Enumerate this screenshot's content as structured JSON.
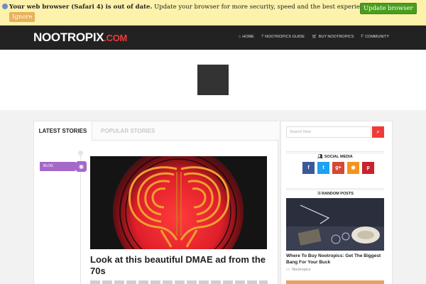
{
  "browser_notice": {
    "bold_text": "Your web browser (Safari 4) is out of date.",
    "text": " Update your browser for more security, speed and the best experience on this site.",
    "update_label": "Update browser",
    "ignore_label": "Ignore"
  },
  "header": {
    "logo_main": "NOOTROPIX",
    "logo_suffix": ".COM",
    "menu": [
      {
        "label": "HOME",
        "icon": "home-icon"
      },
      {
        "label": "NOOTROPICS GUIDE",
        "icon": "question-icon"
      },
      {
        "label": "BUY NOOTROPICS",
        "icon": "cart-icon"
      },
      {
        "label": "COMMUNITY",
        "icon": "facebook-icon"
      }
    ]
  },
  "tabs": {
    "latest": "LATEST STORIES",
    "popular": "POPULAR STORIES"
  },
  "post": {
    "category": "BLOG",
    "category_icon": "camera-icon",
    "title": "Look at this beautiful DMAE ad from the 70s"
  },
  "sidebar": {
    "search_placeholder": "Search Now",
    "social_title": "SOCIAL MEDIA",
    "social": [
      {
        "name": "facebook",
        "glyph": "f",
        "color": "#3b5998"
      },
      {
        "name": "twitter",
        "glyph": "t",
        "color": "#1da1f2"
      },
      {
        "name": "google-plus",
        "glyph": "g+",
        "color": "#d34836"
      },
      {
        "name": "rss",
        "glyph": "◉",
        "color": "#f4941c"
      },
      {
        "name": "pinterest",
        "glyph": "p",
        "color": "#c8232c"
      }
    ],
    "random_title": "RANDOM POSTS",
    "random_post": {
      "title": "Where To Buy Nootropics: Get The Biggest Bang For Your Buck",
      "category": "Nootropics"
    }
  },
  "colors": {
    "accent_red": "#ef3a3a",
    "nav_bg": "#222222",
    "category_purple": "#a569c9",
    "notice_bg": "#fdf2ab"
  }
}
